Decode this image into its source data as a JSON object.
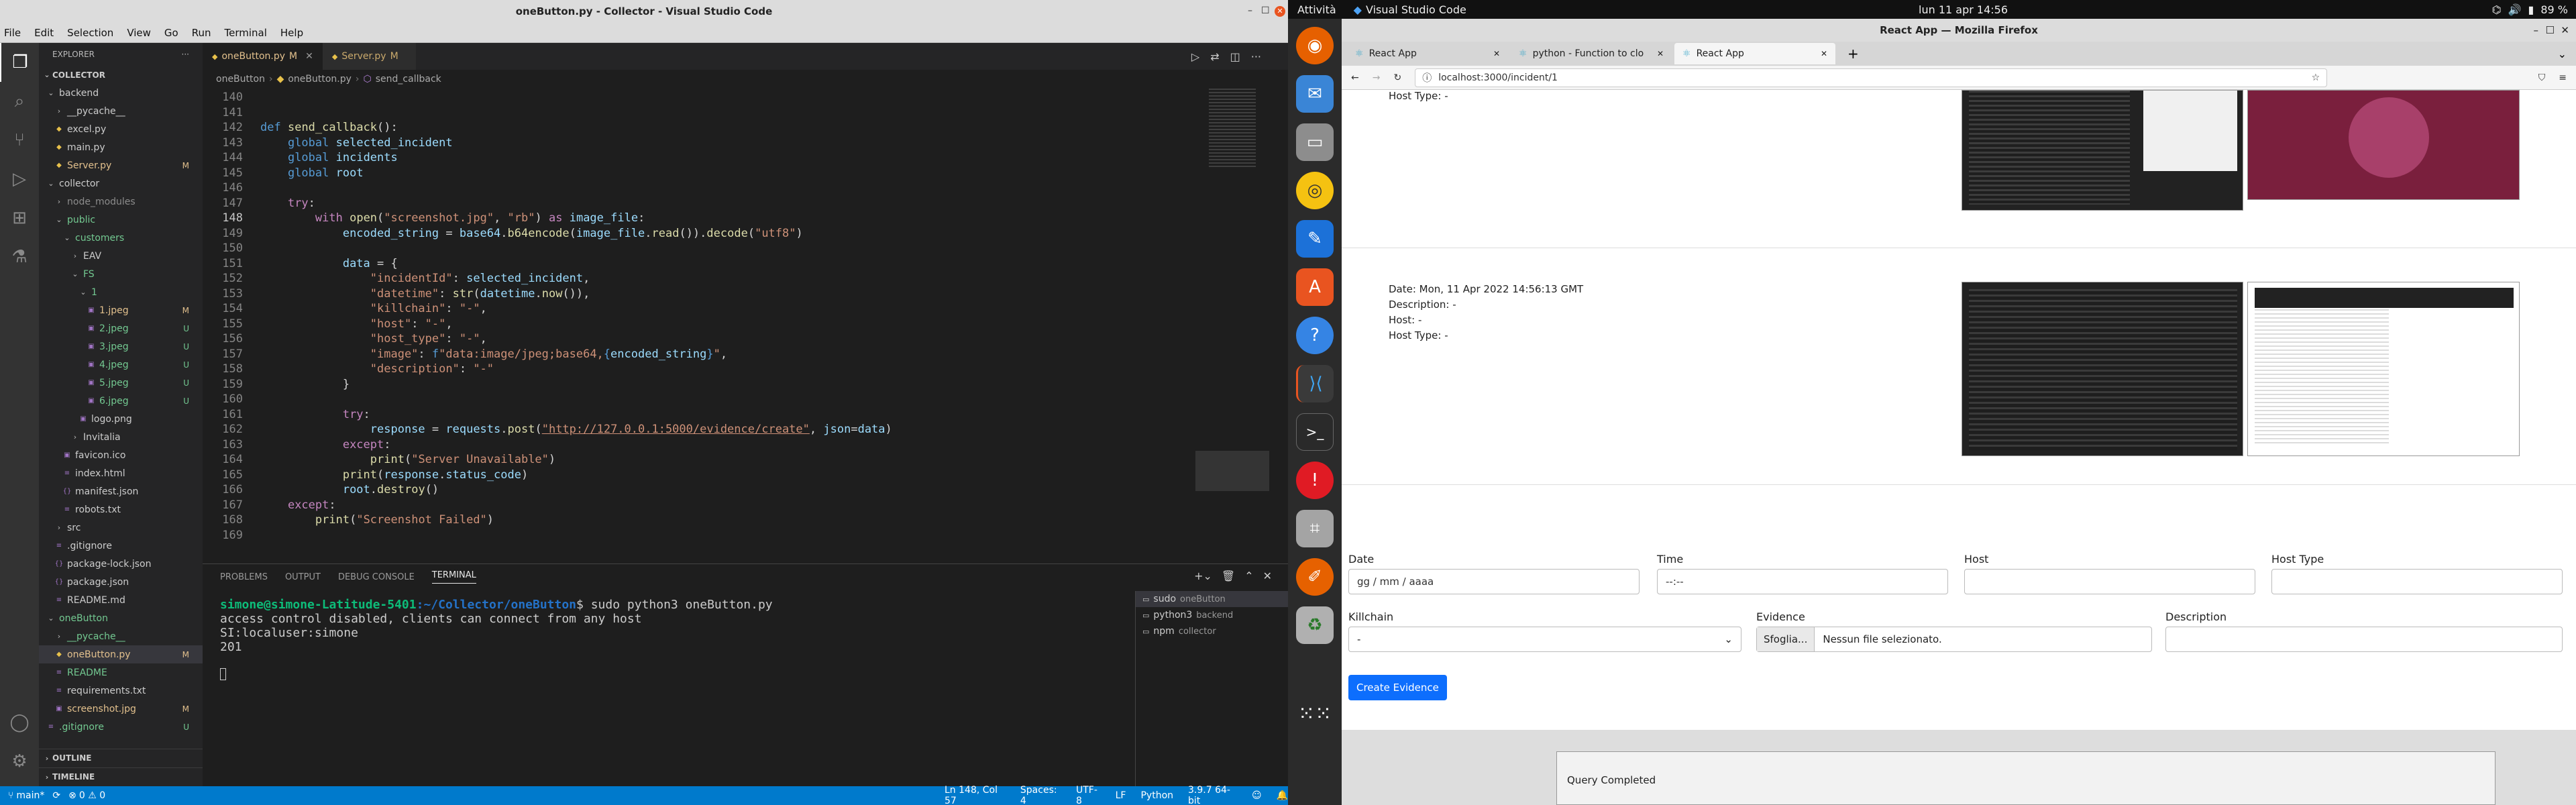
{
  "vscode": {
    "title": "oneButton.py - Collector - Visual Studio Code",
    "menu": [
      "File",
      "Edit",
      "Selection",
      "View",
      "Go",
      "Run",
      "Terminal",
      "Help"
    ],
    "explorer": {
      "header": "EXPLORER",
      "root": "COLLECTOR",
      "items": [
        {
          "label": "backend",
          "kind": "folder",
          "open": true,
          "depth": 0,
          "color": "#cccccc",
          "badge": ""
        },
        {
          "label": "__pycache__",
          "kind": "folder",
          "open": false,
          "depth": 1,
          "color": "#cccccc",
          "badge": ""
        },
        {
          "label": "excel.py",
          "kind": "file",
          "depth": 1,
          "color": "#cccccc",
          "badge": ""
        },
        {
          "label": "main.py",
          "kind": "file",
          "depth": 1,
          "color": "#cccccc",
          "badge": ""
        },
        {
          "label": "Server.py",
          "kind": "file",
          "depth": 1,
          "color": "#e2c08d",
          "badge": "M"
        },
        {
          "label": "collector",
          "kind": "folder",
          "open": true,
          "depth": 0,
          "color": "#cccccc",
          "badge": ""
        },
        {
          "label": "node_modules",
          "kind": "folder",
          "open": false,
          "depth": 1,
          "color": "#8c8c8c",
          "badge": ""
        },
        {
          "label": "public",
          "kind": "folder",
          "open": true,
          "depth": 1,
          "color": "#73c991",
          "badge": ""
        },
        {
          "label": "customers",
          "kind": "folder",
          "open": true,
          "depth": 2,
          "color": "#73c991",
          "badge": ""
        },
        {
          "label": "EAV",
          "kind": "folder",
          "open": false,
          "depth": 3,
          "color": "#cccccc",
          "badge": ""
        },
        {
          "label": "FS",
          "kind": "folder",
          "open": true,
          "depth": 3,
          "color": "#73c991",
          "badge": ""
        },
        {
          "label": "1",
          "kind": "folder",
          "open": true,
          "depth": 4,
          "color": "#73c991",
          "badge": ""
        },
        {
          "label": "1.jpeg",
          "kind": "file",
          "depth": 5,
          "color": "#e2c08d",
          "badge": "M"
        },
        {
          "label": "2.jpeg",
          "kind": "file",
          "depth": 5,
          "color": "#73c991",
          "badge": "U"
        },
        {
          "label": "3.jpeg",
          "kind": "file",
          "depth": 5,
          "color": "#73c991",
          "badge": "U"
        },
        {
          "label": "4.jpeg",
          "kind": "file",
          "depth": 5,
          "color": "#73c991",
          "badge": "U"
        },
        {
          "label": "5.jpeg",
          "kind": "file",
          "depth": 5,
          "color": "#73c991",
          "badge": "U"
        },
        {
          "label": "6.jpeg",
          "kind": "file",
          "depth": 5,
          "color": "#73c991",
          "badge": "U"
        },
        {
          "label": "logo.png",
          "kind": "file",
          "depth": 4,
          "color": "#cccccc",
          "badge": ""
        },
        {
          "label": "Invitalia",
          "kind": "folder",
          "open": false,
          "depth": 3,
          "color": "#cccccc",
          "badge": ""
        },
        {
          "label": "favicon.ico",
          "kind": "file",
          "depth": 2,
          "color": "#cccccc",
          "badge": ""
        },
        {
          "label": "index.html",
          "kind": "file",
          "depth": 2,
          "color": "#cccccc",
          "badge": ""
        },
        {
          "label": "manifest.json",
          "kind": "file",
          "depth": 2,
          "color": "#cccccc",
          "badge": ""
        },
        {
          "label": "robots.txt",
          "kind": "file",
          "depth": 2,
          "color": "#cccccc",
          "badge": ""
        },
        {
          "label": "src",
          "kind": "folder",
          "open": false,
          "depth": 1,
          "color": "#cccccc",
          "badge": ""
        },
        {
          "label": ".gitignore",
          "kind": "file",
          "depth": 1,
          "color": "#cccccc",
          "badge": ""
        },
        {
          "label": "package-lock.json",
          "kind": "file",
          "depth": 1,
          "color": "#cccccc",
          "badge": ""
        },
        {
          "label": "package.json",
          "kind": "file",
          "depth": 1,
          "color": "#cccccc",
          "badge": ""
        },
        {
          "label": "README.md",
          "kind": "file",
          "depth": 1,
          "color": "#cccccc",
          "badge": ""
        },
        {
          "label": "oneButton",
          "kind": "folder",
          "open": true,
          "depth": 0,
          "color": "#73c991",
          "badge": ""
        },
        {
          "label": "__pycache__",
          "kind": "folder",
          "open": false,
          "depth": 1,
          "color": "#73c991",
          "badge": ""
        },
        {
          "label": "oneButton.py",
          "kind": "file",
          "depth": 1,
          "color": "#e2c08d",
          "badge": "M",
          "selected": true
        },
        {
          "label": "README",
          "kind": "file",
          "depth": 1,
          "color": "#73c991",
          "badge": ""
        },
        {
          "label": "requirements.txt",
          "kind": "file",
          "depth": 1,
          "color": "#cccccc",
          "badge": ""
        },
        {
          "label": "screenshot.jpg",
          "kind": "file",
          "depth": 1,
          "color": "#e2c08d",
          "badge": "M"
        },
        {
          "label": ".gitignore",
          "kind": "file",
          "depth": 0,
          "color": "#73c991",
          "badge": "U"
        }
      ],
      "outline": "OUTLINE",
      "timeline": "TIMELINE"
    },
    "tabs": [
      {
        "label": "oneButton.py",
        "badge": "M",
        "active": true
      },
      {
        "label": "Server.py",
        "badge": "M",
        "active": false
      }
    ],
    "breadcrumb": [
      "oneButton",
      "oneButton.py",
      "send_callback"
    ],
    "code_lines": [
      {
        "n": "140",
        "h": ""
      },
      {
        "n": "141",
        "h": ""
      },
      {
        "n": "142",
        "h": "<span class='df'>def</span> <span class='fn'>send_callback</span>():"
      },
      {
        "n": "143",
        "h": "    <span class='df'>global</span> <span class='vr'>selected_incident</span>"
      },
      {
        "n": "144",
        "h": "    <span class='df'>global</span> <span class='vr'>incidents</span>"
      },
      {
        "n": "145",
        "h": "    <span class='df'>global</span> <span class='vr'>root</span>"
      },
      {
        "n": "146",
        "h": ""
      },
      {
        "n": "147",
        "h": "    <span class='kw'>try</span>:"
      },
      {
        "n": "148",
        "h": "        <span class='kw'>with</span> <span class='fn'>open</span>(<span class='st'>\"screenshot.jpg\"</span>, <span class='st'>\"rb\"</span>) <span class='kw'>as</span> <span class='vr'>image_file</span>:"
      },
      {
        "n": "149",
        "h": "            <span class='vr'>encoded_string</span> = <span class='vr'>base64</span>.<span class='fn'>b64encode</span>(<span class='vr'>image_file</span>.<span class='fn'>read</span>()).<span class='fn'>decode</span>(<span class='st'>\"utf8\"</span>)"
      },
      {
        "n": "150",
        "h": ""
      },
      {
        "n": "151",
        "h": "            <span class='vr'>data</span> = {"
      },
      {
        "n": "152",
        "h": "                <span class='st'>\"incidentId\"</span>: <span class='vr'>selected_incident</span>,"
      },
      {
        "n": "153",
        "h": "                <span class='st'>\"datetime\"</span>: <span class='fn'>str</span>(<span class='vr'>datetime</span>.<span class='fn'>now</span>()),"
      },
      {
        "n": "154",
        "h": "                <span class='st'>\"killchain\"</span>: <span class='st'>\"-\"</span>,"
      },
      {
        "n": "155",
        "h": "                <span class='st'>\"host\"</span>: <span class='st'>\"-\"</span>,"
      },
      {
        "n": "156",
        "h": "                <span class='st'>\"host_type\"</span>: <span class='st'>\"-\"</span>,"
      },
      {
        "n": "157",
        "h": "                <span class='st'>\"image\"</span>: <span class='df'>f</span><span class='st'>\"data:image/jpeg;base64,</span><span class='df'>{</span><span class='vr'>encoded_string</span><span class='df'>}</span><span class='st'>\"</span>,"
      },
      {
        "n": "158",
        "h": "                <span class='st'>\"description\"</span>: <span class='st'>\"-\"</span>"
      },
      {
        "n": "159",
        "h": "            }"
      },
      {
        "n": "160",
        "h": ""
      },
      {
        "n": "161",
        "h": "            <span class='kw'>try</span>:"
      },
      {
        "n": "162",
        "h": "                <span class='vr'>response</span> = <span class='vr'>requests</span>.<span class='fn'>post</span>(<span class='un'>\"http://127.0.0.1:5000/evidence/create\"</span>, <span class='vr'>json</span>=<span class='vr'>data</span>)"
      },
      {
        "n": "163",
        "h": "            <span class='kw'>except</span>:"
      },
      {
        "n": "164",
        "h": "                <span class='fn'>print</span>(<span class='st'>\"Server Unavailable\"</span>)"
      },
      {
        "n": "165",
        "h": "            <span class='fn'>print</span>(<span class='vr'>response</span>.<span class='vr'>status_code</span>)"
      },
      {
        "n": "166",
        "h": "            <span class='vr'>root</span>.<span class='fn'>destroy</span>()"
      },
      {
        "n": "167",
        "h": "    <span class='kw'>except</span>:"
      },
      {
        "n": "168",
        "h": "        <span class='fn'>print</span>(<span class='st'>\"Screenshot Failed\"</span>)"
      },
      {
        "n": "169",
        "h": ""
      }
    ],
    "panel_tabs": [
      "PROBLEMS",
      "OUTPUT",
      "DEBUG CONSOLE",
      "TERMINAL"
    ],
    "terminal": {
      "prompt": "simone@simone-Latitude-5401",
      "path": ":~/Collector/oneButton",
      "cmd": "$ sudo python3 oneButton.py",
      "out": [
        "access control disabled, clients can connect from any host",
        "SI:localuser:simone",
        "201"
      ],
      "list": [
        {
          "name": "sudo",
          "sub": "oneButton"
        },
        {
          "name": "python3",
          "sub": "backend"
        },
        {
          "name": "npm",
          "sub": "collector"
        }
      ]
    },
    "status": {
      "branch": "main*",
      "problems": "0 ⚠ 0",
      "position": "Ln 148, Col 57",
      "spaces": "Spaces: 4",
      "encoding": "UTF-8",
      "eol": "LF",
      "lang": "Python",
      "interp": "3.9.7 64-bit"
    }
  },
  "desktop": {
    "activities": "Attività",
    "app": "Visual Studio Code",
    "clock": "lun 11 apr  14:56",
    "battery": "89 %"
  },
  "firefox": {
    "title": "React App — Mozilla Firefox",
    "tabs": [
      {
        "label": "React App",
        "active": false
      },
      {
        "label": "python - Function to clo",
        "active": false
      },
      {
        "label": "React App",
        "active": true
      }
    ],
    "url": "localhost:3000/incident/1",
    "partial": "Host Type: -",
    "entry": {
      "date": "Date: Mon, 11 Apr 2022 14:56:13 GMT",
      "desc": "Description: -",
      "host": "Host: -",
      "host_type": "Host Type: -"
    },
    "form": {
      "date_label": "Date",
      "time_label": "Time",
      "host_label": "Host",
      "host_type_label": "Host Type",
      "date_ph": "gg / mm / aaaa",
      "time_ph": "--:--",
      "killchain_label": "Killchain",
      "killchain_value": "-",
      "evidence_label": "Evidence",
      "browse": "Sfoglia...",
      "no_file": "Nessun file selezionato.",
      "description_label": "Description",
      "submit": "Create Evidence"
    },
    "behind_status": "Query Completed"
  }
}
